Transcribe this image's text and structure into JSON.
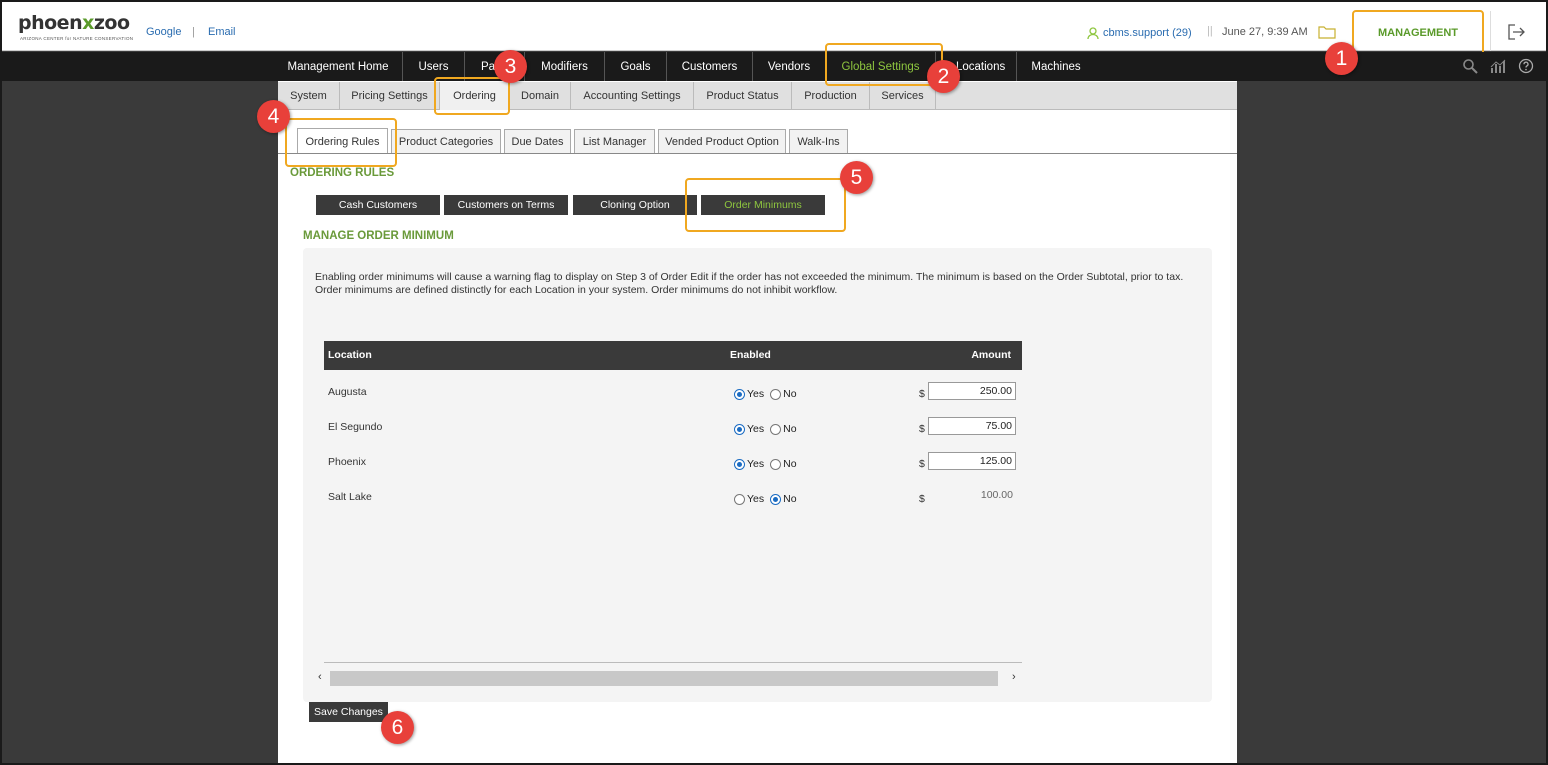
{
  "header": {
    "logo_main_pre": "phoen",
    "logo_main_mid": "x",
    "logo_main_post": "zoo",
    "logo_sub": "ARIZONA CENTER for NATURE CONSERVATION",
    "links": [
      "Google",
      "Email"
    ],
    "link_separator": "|",
    "user": "cbms.support (29)",
    "separator": "||",
    "datetime": "June 27, 9:39 AM",
    "management": "MANAGEMENT"
  },
  "main_nav": [
    "Management Home",
    "Users",
    "Pa",
    "Modifiers",
    "Goals",
    "Customers",
    "Vendors",
    "Global Settings",
    "Locations",
    "Machines"
  ],
  "sub_nav": [
    "System",
    "Pricing Settings",
    "Ordering",
    "Domain",
    "Accounting Settings",
    "Product Status",
    "Production",
    "Services"
  ],
  "tabs": [
    "Ordering Rules",
    "Product Categories",
    "Due Dates",
    "List Manager",
    "Vended Product Option",
    "Walk-Ins"
  ],
  "section_title": "ORDERING RULES",
  "sub_buttons": [
    "Cash Customers",
    "Customers on Terms",
    "Cloning Option",
    "Order Minimums"
  ],
  "manage_title": "MANAGE ORDER MINIMUM",
  "description": "Enabling order minimums will cause a warning flag to display on Step 3 of Order Edit if the order has not exceeded the minimum. The minimum is based on the Order Subtotal, prior to tax. Order minimums are defined distinctly for each Location in your system. Order minimums do not inhibit workflow.",
  "table": {
    "headers": [
      "Location",
      "Enabled",
      "Amount"
    ],
    "yes_label": "Yes",
    "no_label": "No",
    "currency": "$",
    "rows": [
      {
        "location": "Augusta",
        "enabled": true,
        "amount": "250.00"
      },
      {
        "location": "El Segundo",
        "enabled": true,
        "amount": "75.00"
      },
      {
        "location": "Phoenix",
        "enabled": true,
        "amount": "125.00"
      },
      {
        "location": "Salt Lake",
        "enabled": false,
        "amount": "100.00"
      }
    ]
  },
  "scroll_left": "‹",
  "scroll_right": "›",
  "save_button": "Save Changes",
  "badges": [
    "1",
    "2",
    "3",
    "4",
    "5",
    "6"
  ],
  "colors": {
    "highlight": "#f0a820",
    "badge": "#e8403a",
    "accent_green": "#8ec63f",
    "title_green": "#6a9a3a",
    "nav_bg": "#1a1a1a"
  }
}
